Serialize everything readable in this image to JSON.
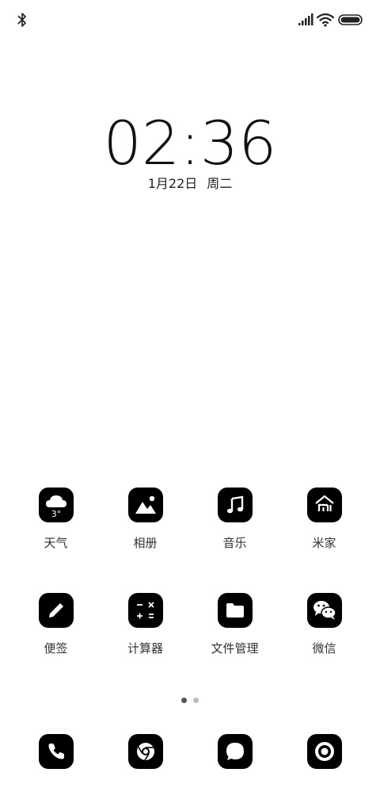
{
  "status_bar": {
    "left_icon": "bluetooth-icon",
    "right_icons": [
      "signal-icon",
      "wifi-icon",
      "battery-icon"
    ]
  },
  "lockscreen": {
    "time_hour": "02",
    "time_sep": ":",
    "time_minute": "36",
    "date": "1月22日",
    "weekday": "周二"
  },
  "apps": [
    {
      "label": "天气",
      "icon": "weather-icon",
      "badge": "3°"
    },
    {
      "label": "相册",
      "icon": "gallery-icon"
    },
    {
      "label": "音乐",
      "icon": "music-icon"
    },
    {
      "label": "米家",
      "icon": "mi-home-icon"
    },
    {
      "label": "便签",
      "icon": "notes-icon"
    },
    {
      "label": "计算器",
      "icon": "calculator-icon"
    },
    {
      "label": "文件管理",
      "icon": "file-manager-icon"
    },
    {
      "label": "微信",
      "icon": "wechat-icon"
    }
  ],
  "pager": {
    "pages": 2,
    "active": 1
  },
  "dock": [
    {
      "icon": "phone-icon"
    },
    {
      "icon": "browser-icon"
    },
    {
      "icon": "messages-icon"
    },
    {
      "icon": "camera-icon"
    }
  ],
  "colors": {
    "icon_bg": "#000000",
    "background": "#ffffff",
    "text": "#333333"
  }
}
